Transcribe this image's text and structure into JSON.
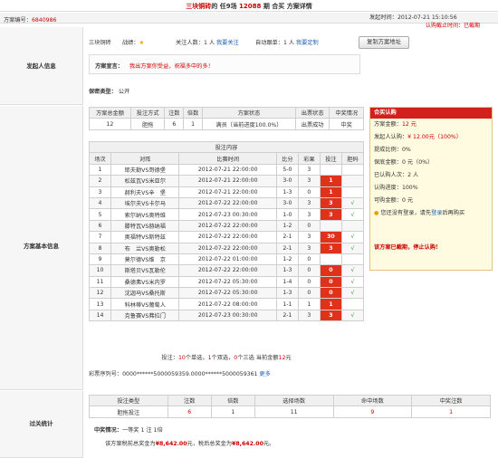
{
  "title": {
    "prefix": "三块铜砖",
    "mid": "的 任9场 ",
    "issue": "12088",
    "suffix": " 期 合买 方案详情"
  },
  "plan_no_label": "方案编号：",
  "plan_no": "6840986",
  "publish_label": "发起时间：",
  "publish_time": "2012-07-21 15:10:56",
  "deadline_label": "认购截止时间：",
  "deadline": "已截期",
  "sec1": "发起人信息",
  "sec2": "方案基本信息",
  "sec3": "过关统计",
  "user": {
    "name": "三块铜砖",
    "record_label": "战绩：",
    "follow_label": "关注人数：",
    "follow_count": "1 人",
    "follow_link": "我要关注",
    "auto_label": "自动跟单：",
    "auto_count": "1 人",
    "auto_link": "我要定制",
    "copy_btn": "复制方案地址"
  },
  "decl": {
    "label": "方案宣言：",
    "text": "我出方案你受益，祝福多中的多！"
  },
  "secret": {
    "label": "保密类型：",
    "value": "公开"
  },
  "summary": {
    "headers": [
      "方案总金额",
      "投注方式",
      "注数",
      "倍数",
      "方案状态",
      "出票状态",
      "中奖情况"
    ],
    "values": [
      "12",
      "胆拖",
      "6",
      "1",
      "满员（当前进度100.0%）",
      "出票成功",
      "中奖"
    ]
  },
  "bets_title": "投注内容",
  "bets_headers": [
    "场次",
    "对阵",
    "比赛时间",
    "比分",
    "彩果",
    "投注",
    "胆码"
  ],
  "matches": [
    {
      "n": "1",
      "t": "耶夫勒VS哥德堡",
      "time": "2012-07-21 22:00:00",
      "s": "5-0",
      "r": "3",
      "b": "",
      "d": ""
    },
    {
      "n": "2",
      "t": "松兹瓦VS米亚尔",
      "time": "2012-07-21 22:00:00",
      "s": "3-0",
      "r": "3",
      "b": "1",
      "d": ""
    },
    {
      "n": "3",
      "t": "赫利夫VS辛　堡",
      "time": "2012-07-21 22:00:00",
      "s": "1-3",
      "r": "0",
      "b": "1",
      "d": ""
    },
    {
      "n": "4",
      "t": "埃尔夫VS卡尔马",
      "time": "2012-07-22 22:00:00",
      "s": "3-0",
      "r": "3",
      "b": "3",
      "d": "√"
    },
    {
      "n": "5",
      "t": "索尔纳VS奥特维",
      "time": "2012-07-23 00:30:00",
      "s": "1-0",
      "r": "3",
      "b": "3",
      "d": "√"
    },
    {
      "n": "6",
      "t": "滕特瓦VS赫纳福",
      "time": "2012-07-22 22:00:00",
      "s": "1-2",
      "r": "0",
      "b": "",
      "d": ""
    },
    {
      "n": "7",
      "t": "奥福特VS斯特兹",
      "time": "2012-07-22 22:00:00",
      "s": "2-1",
      "r": "3",
      "b": "30",
      "d": "√"
    },
    {
      "n": "8",
      "t": "布　兰VS奥勒松",
      "time": "2012-07-22 22:00:00",
      "s": "2-1",
      "r": "3",
      "b": "3",
      "d": "√"
    },
    {
      "n": "9",
      "t": "莫尔德VS维　京",
      "time": "2012-07-22 01:00:00",
      "s": "1-2",
      "r": "0",
      "b": "",
      "d": ""
    },
    {
      "n": "10",
      "t": "斯塔贝VS瓦勒伦",
      "time": "2012-07-22 22:00:00",
      "s": "1-3",
      "r": "0",
      "b": "0",
      "d": "√"
    },
    {
      "n": "11",
      "t": "桑德弗VS米内罗",
      "time": "2012-07-22 05:30:00",
      "s": "1-4",
      "r": "0",
      "b": "0",
      "d": "√"
    },
    {
      "n": "12",
      "t": "沈迦马VS桑托斯",
      "time": "2012-07-22 05:30:00",
      "s": "1-3",
      "r": "0",
      "b": "0",
      "d": "√"
    },
    {
      "n": "13",
      "t": "科林蒂VS葡萄人",
      "time": "2012-07-22 08:00:00",
      "s": "1-1",
      "r": "1",
      "b": "1",
      "d": ""
    },
    {
      "n": "14",
      "t": "克鲁赛VS弗拉门",
      "time": "2012-07-23 00:30:00",
      "s": "2-1",
      "r": "3",
      "b": "3",
      "d": "√"
    }
  ],
  "bets_footer": {
    "p1": "投注：",
    "c1": "10",
    "p2": "个单选，",
    "c2": "1",
    "p3": "个双选，",
    "c3": "0",
    "p4": "个三选 当前金额",
    "amt": "12",
    "p5": "元"
  },
  "serial": {
    "label": "彩票序列号：",
    "value": "0000******5000059359.0000******5000059361",
    "more": "更多"
  },
  "join": {
    "title": "合买认购",
    "total_label": "方案金额：",
    "total": "12 元",
    "sponsor_label": "发起人认购：",
    "sponsor": "¥ 12.00元（100%）",
    "pct_label": "提成比例：",
    "pct": "0%",
    "guar_label": "保底金额：",
    "guar": "0 元（0%）",
    "joined_label": "已认购人次：",
    "joined": "2 人",
    "prog_label": "认购进度：",
    "prog": "100%",
    "avail_label": "可购金额：",
    "avail": "0 元",
    "login_pre": "您还没有登录，请先",
    "login_link": "登录",
    "login_post": "后再购买",
    "expired": "该方案已截期，停止认购！"
  },
  "pass": {
    "headers": [
      "投注类型",
      "注数",
      "倍数",
      "选择场数",
      "命中场数",
      "中奖注数"
    ],
    "values": [
      "胆拖投注",
      "6",
      "1",
      "11",
      "9",
      "1"
    ],
    "win_label": "中奖情况：",
    "win_text": "一等奖 1 注 1倍",
    "pre_tax_pre": "该方案税前总奖金为",
    "pre_tax": "¥8,642.00",
    "pre_tax_post": "元，税后总奖金为",
    "post_tax": "¥8,642.00",
    "post_tax_post": "元。"
  },
  "colors": {
    "red": "#c00",
    "bet_highlight": "#e0321b",
    "link": "#1a5fb4"
  }
}
